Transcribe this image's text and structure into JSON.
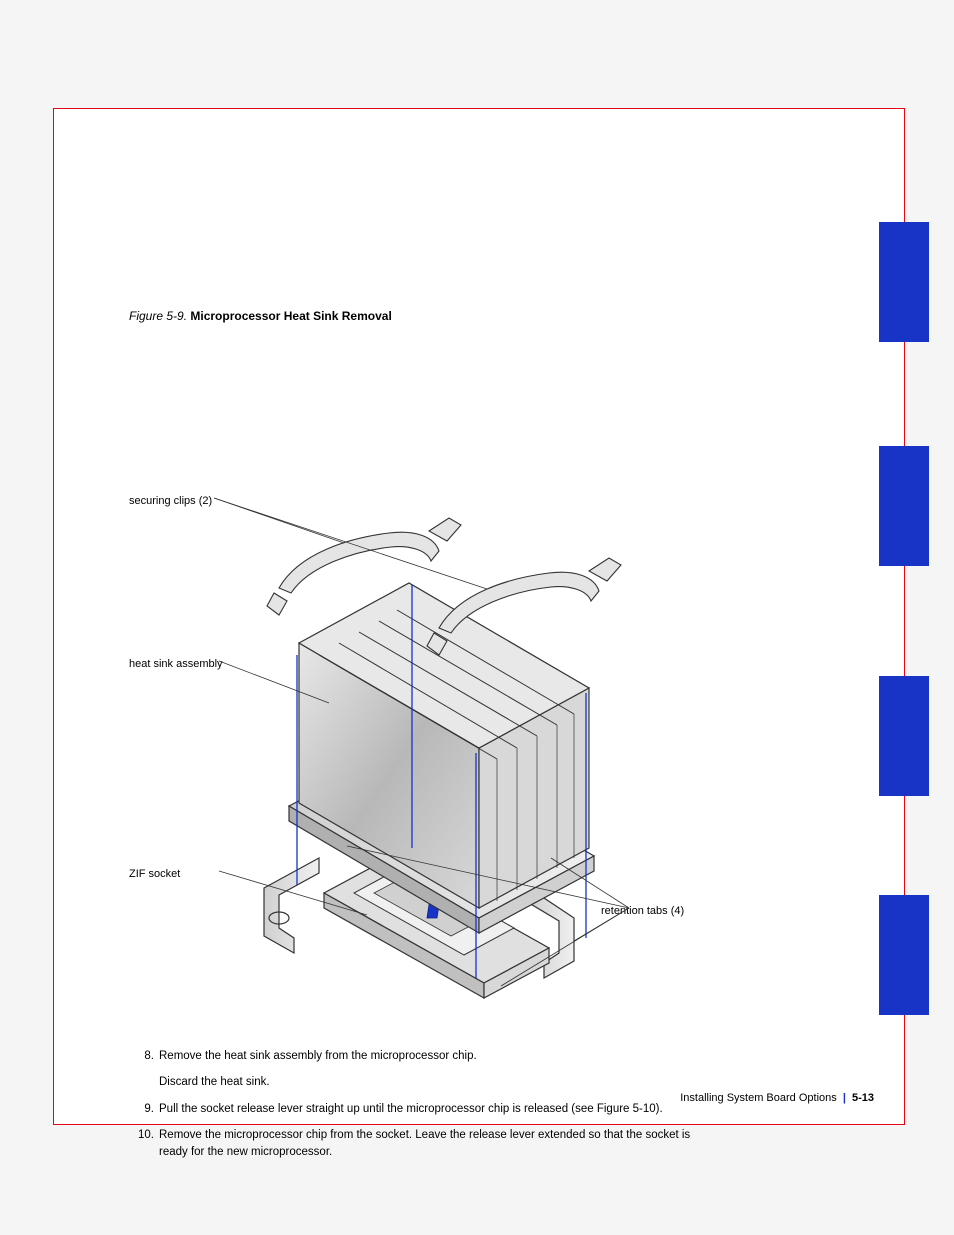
{
  "figure": {
    "number": "Figure 5-9.",
    "title": "Microprocessor Heat Sink Removal"
  },
  "callouts": {
    "securing_clips": "securing clips (2)",
    "heat_sink": "heat sink assembly",
    "retention_tabs": "retention tabs (4)",
    "ZIF_socket": "ZIF socket"
  },
  "steps": [
    {
      "num": "8.",
      "text": "Remove the heat sink assembly from the microprocessor chip."
    },
    {
      "num": "",
      "text": "Discard the heat sink."
    },
    {
      "num": "9.",
      "text": "Pull the socket release lever straight up until the microprocessor chip is released (see Figure 5-10)."
    },
    {
      "num": "10.",
      "text": "Remove the microprocessor chip from the socket. Leave the release lever extended so that the socket is ready for the new microprocessor."
    }
  ],
  "footer": {
    "text": "Installing System Board Options",
    "page": "5-13"
  }
}
